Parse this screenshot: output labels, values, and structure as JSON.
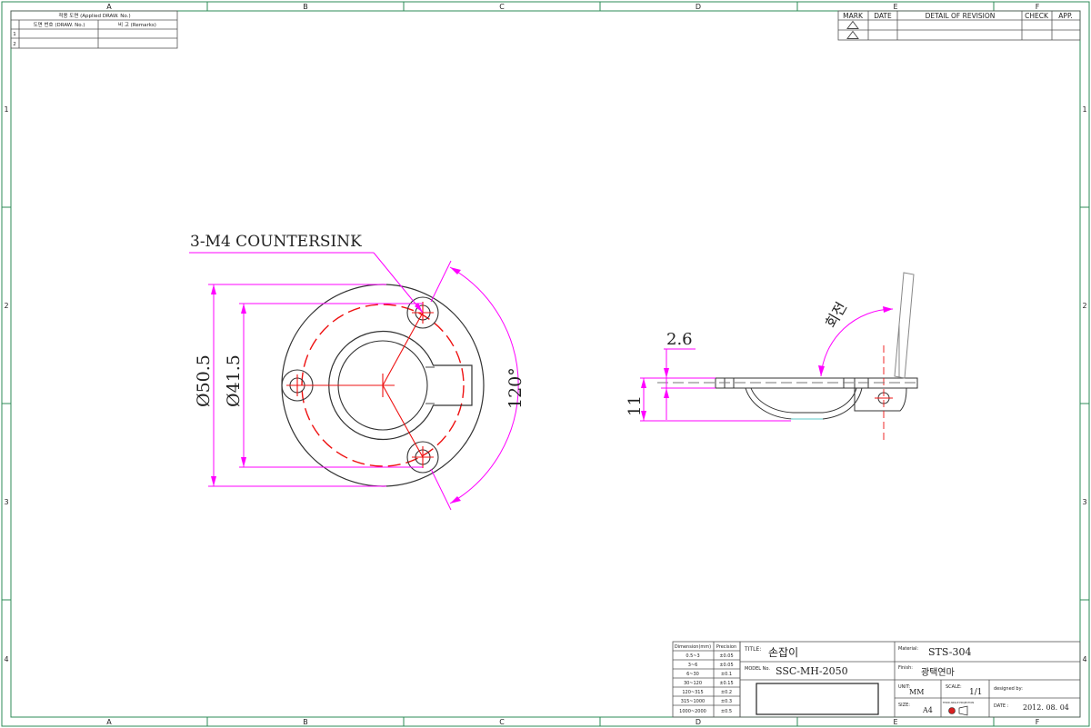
{
  "frame": {
    "zones_top": [
      "A",
      "B",
      "C",
      "D",
      "E",
      "F"
    ],
    "zones_bottom": [
      "A",
      "B",
      "C",
      "D",
      "E",
      "F"
    ],
    "rows_left": [
      "1",
      "2",
      "3",
      "4"
    ],
    "rows_right": [
      "1",
      "2",
      "3",
      "4"
    ]
  },
  "applied_table": {
    "header": "적용 도면 (Applied DRAW. No.)",
    "col1": "도면 번호 (DRAW. No.)",
    "col2": "비 고 (Remarks)",
    "rows": [
      "1",
      "2"
    ]
  },
  "revision_table": {
    "headers": [
      "MARK",
      "DATE",
      "DETAIL OF REVISION",
      "CHECK",
      "APP."
    ]
  },
  "annotations": {
    "countersink": "3-M4 COUNTERSINK",
    "dia_outer": "Ø50.5",
    "dia_pcd": "Ø41.5",
    "angle": "120°",
    "thickness": "2.6",
    "height": "11",
    "rotation": "회전"
  },
  "tolerance_table": {
    "header_dim": "Dimension(mm)",
    "header_prec": "Precision",
    "rows": [
      [
        "0.5~3",
        "±0.05"
      ],
      [
        "3~6",
        "±0.05"
      ],
      [
        "6~30",
        "±0.1"
      ],
      [
        "30~120",
        "±0.15"
      ],
      [
        "120~315",
        "±0.2"
      ],
      [
        "315~1000",
        "±0.3"
      ],
      [
        "1000~2000",
        "±0.5"
      ]
    ]
  },
  "title_block": {
    "title_label": "TITLE:",
    "title_value": "손잡이",
    "model_label": "MODEL No.",
    "model_value": "SSC-MH-2050",
    "material_label": "Material:",
    "material_value": "STS-304",
    "finish_label": "Finish:",
    "finish_value": "광택연마",
    "unit_label": "UNIT:",
    "unit_value": "MM",
    "scale_label": "SCALE:",
    "scale_value": "1/1",
    "designed_label": "designed by:",
    "size_label": "SIZE:",
    "size_value": "A4",
    "projection_label": "THIRD ANGLE PROJECTION",
    "date_label": "DATE :",
    "date_value": "2012. 08. 04"
  },
  "colors": {
    "frame": "#2e8b57",
    "part": "#333333",
    "centerline": "#ee1111",
    "dimension": "#ff00ff",
    "table_line": "#555555"
  }
}
